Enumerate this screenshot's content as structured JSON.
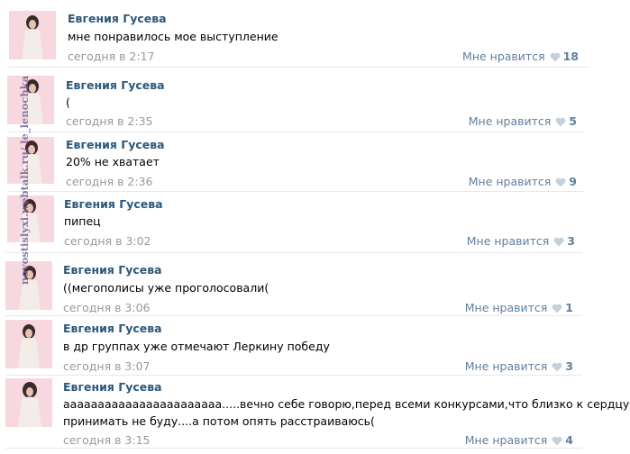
{
  "posts": [
    {
      "author": "Евгения Гусева",
      "text": "мне понравилось мое выступление",
      "date": "сегодня в 2:17",
      "like_label": "Мне нравится",
      "likes": "18"
    },
    {
      "author": "Евгения Гусева",
      "text": "(",
      "date": "сегодня в 2:35",
      "like_label": "Мне нравится",
      "likes": "5"
    },
    {
      "author": "Евгения Гусева",
      "text": "20% не хватает",
      "date": "сегодня в 2:36",
      "like_label": "Мне нравится",
      "likes": "9"
    },
    {
      "author": "Евгения Гусева",
      "text": "пипец",
      "date": "сегодня в 3:02",
      "like_label": "Мне нравится",
      "likes": "3"
    },
    {
      "author": "Евгения Гусева",
      "text": "((мегополисы уже проголосовали(",
      "date": "сегодня в 3:06",
      "like_label": "Мне нравится",
      "likes": "1"
    },
    {
      "author": "Евгения Гусева",
      "text": "в др группах уже отмечают Леркину победу",
      "date": "сегодня в 3:07",
      "like_label": "Мне нравится",
      "likes": "3"
    },
    {
      "author": "Евгения Гусева",
      "text": "ааааааааааааааааааааааа.....вечно себе говорю,перед всеми конкурсами,что близко к сердцу",
      "text2": "принимать не буду....а потом опять расстраиваюсь(",
      "date": "сегодня в 3:15",
      "like_label": "Мне нравится",
      "likes": "4"
    }
  ],
  "watermark": "novostislyxi.webtalk.ru/ le_lenochka",
  "colors": {
    "author": "#2b587a",
    "meta": "#999999",
    "likes": "#5f7f9f",
    "heart": "#c5d0dc",
    "separator": "#e4e8ed"
  }
}
